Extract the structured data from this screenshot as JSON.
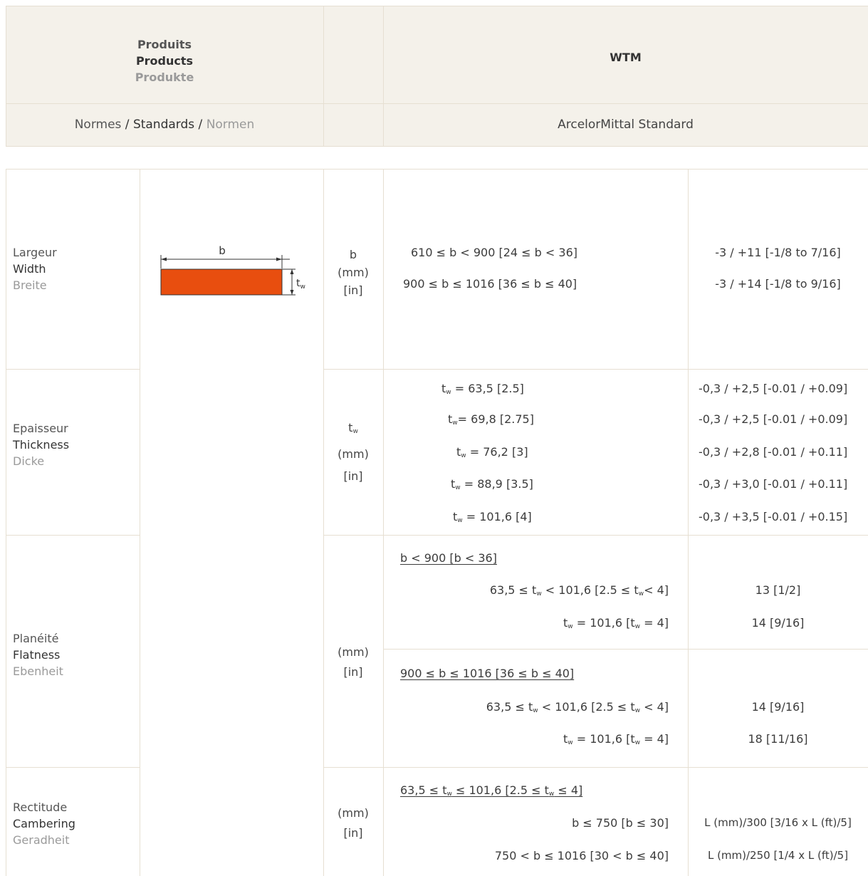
{
  "header": {
    "products_fr": "Produits",
    "products_en": "Products",
    "products_de": "Produkte",
    "product_name": "WTM",
    "standards_fr": "Normes",
    "standards_sep1": " / ",
    "standards_en": "Standards",
    "standards_sep2": " / ",
    "standards_de": "Normen",
    "standard_value": "ArcelorMittal Standard"
  },
  "diagram": {
    "b_label": "b",
    "tw_label": "t",
    "tw_sub": "w",
    "bar_color": "#e84e0f"
  },
  "width": {
    "label_fr": "Largeur",
    "label_en": "Width",
    "label_de": "Breite",
    "symbol": "b",
    "unit_mm": "(mm)",
    "unit_in": "[in]",
    "rows": [
      {
        "range": "610 ≤ b < 900 [24 ≤ b < 36]",
        "tolerance": "-3 / +11 [-1/8 to 7/16]"
      },
      {
        "range": "900 ≤ b ≤ 1016 [36 ≤ b ≤ 40]",
        "tolerance": "-3 / +14 [-1/8 to 9/16]"
      }
    ]
  },
  "thickness": {
    "label_fr": "Epaisseur",
    "label_en": "Thickness",
    "label_de": "Dicke",
    "symbol": "t",
    "symbol_sub": "w",
    "unit_mm": "(mm)",
    "unit_in": "[in]",
    "rows": [
      {
        "sym": "t",
        "sub": "w",
        "value": " = 63,5 [2.5]",
        "tolerance": "-0,3 / +2,5 [-0.01 / +0.09]"
      },
      {
        "sym": "t",
        "sub": "w",
        "value": "= 69,8 [2.75]",
        "tolerance": "-0,3 / +2,5 [-0.01 / +0.09]"
      },
      {
        "sym": "t",
        "sub": "w",
        "value": " = 76,2 [3]",
        "tolerance": "-0,3 / +2,8 [-0.01 / +0.11]"
      },
      {
        "sym": "t",
        "sub": "w",
        "value": " = 88,9 [3.5]",
        "tolerance": "-0,3 / +3,0 [-0.01 / +0.11]"
      },
      {
        "sym": "t",
        "sub": "w",
        "value": " = 101,6 [4]",
        "tolerance": "-0,3 / +3,5 [-0.01 / +0.15]"
      }
    ]
  },
  "flatness": {
    "label_fr": "Planéité",
    "label_en": "Flatness",
    "label_de": "Ebenheit",
    "unit_mm": "(mm)",
    "unit_in": "[in]",
    "group1_title": "b < 900 [b < 36]",
    "group1_r1_a": "63,5 ≤ t",
    "group1_r1_b": " < 101,6  [2.5 ≤ t",
    "group1_r1_c": "< 4]",
    "group1_r1_tol": "13 [1/2]",
    "group1_r2_a": "t",
    "group1_r2_b": " = 101,6  [t",
    "group1_r2_c": " = 4]",
    "group1_r2_tol": "14 [9/16]",
    "group2_title": "900 ≤ b ≤ 1016 [36 ≤ b ≤ 40]",
    "group2_r1_a": "63,5 ≤ t",
    "group2_r1_b": " < 101,6  [2.5 ≤ t",
    "group2_r1_c": " < 4]",
    "group2_r1_tol": "14 [9/16]",
    "group2_r2_a": "t",
    "group2_r2_b": " = 101,6  [t",
    "group2_r2_c": " = 4]",
    "group2_r2_tol": "18 [11/16]",
    "sub": "w"
  },
  "camber": {
    "label_fr": "Rectitude",
    "label_en": "Cambering",
    "label_de": "Geradheit",
    "unit_mm": "(mm)",
    "unit_in": "[in]",
    "title_a": "63,5 ≤ t",
    "title_b": " ≤ 101,6 [2.5 ≤ t",
    "title_c": " ≤ 4]",
    "sub": "w",
    "r1": "b ≤ 750 [b ≤ 30]",
    "r1_tol": "L (mm)/300 [3/16 x L (ft)/5]",
    "r2": "750 < b ≤ 1016 [30 < b ≤ 40]",
    "r2_tol": "L (mm)/250 [1/4 x L (ft)/5]"
  }
}
